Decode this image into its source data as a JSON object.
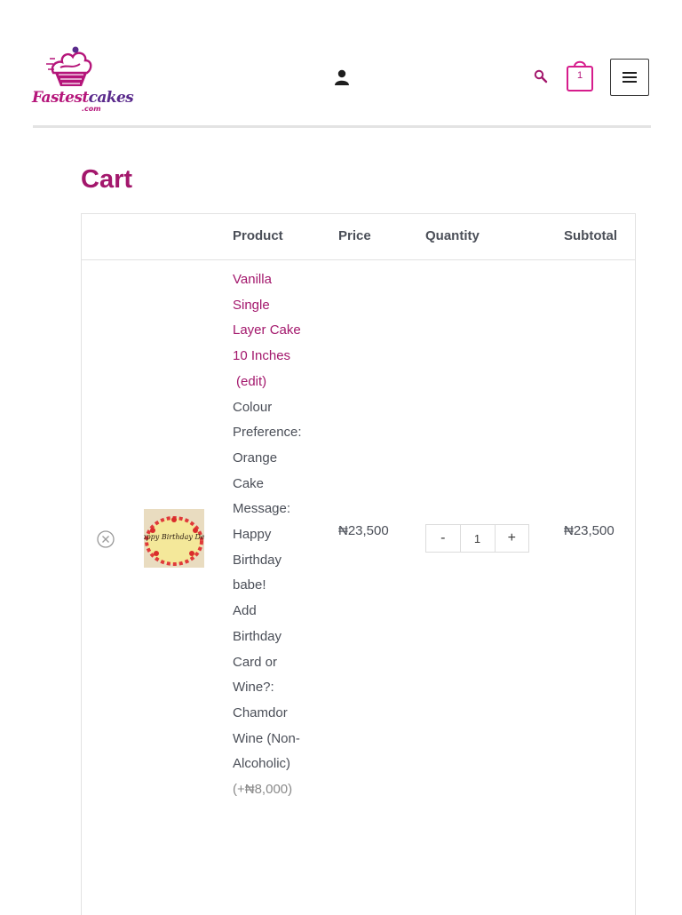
{
  "brand": {
    "name_main": "Fastest",
    "name_accent": "cakes",
    "domain_suffix": ".com",
    "primary_color": "#a3176c",
    "secondary_color": "#5a2a8c"
  },
  "header": {
    "icons": [
      "account-icon",
      "search-icon",
      "cart-icon",
      "hamburger-menu-icon"
    ],
    "cart_count": "1"
  },
  "page": {
    "title": "Cart"
  },
  "cart": {
    "columns": {
      "remove": "",
      "thumbnail": "",
      "product": "Product",
      "price": "Price",
      "quantity": "Quantity",
      "subtotal": "Subtotal"
    },
    "items": [
      {
        "product_lines": [
          "Vanilla",
          "Single",
          "Layer Cake",
          "10 Inches"
        ],
        "edit_label": "(edit)",
        "meta_lines": [
          "Colour",
          "Preference:",
          "Orange",
          "Cake",
          "Message:",
          "Happy",
          "Birthday",
          "babe!",
          "Add",
          "Birthday",
          "Card or",
          "Wine?:",
          "Chamdor",
          "Wine (Non-",
          "Alcoholic)"
        ],
        "addon_price": "(+₦8,000)",
        "price": "₦23,500",
        "quantity": "1",
        "qty_minus": "-",
        "qty_plus": "+",
        "subtotal": "₦23,500",
        "cake_text": "Happy Birthday Dear"
      }
    ]
  }
}
